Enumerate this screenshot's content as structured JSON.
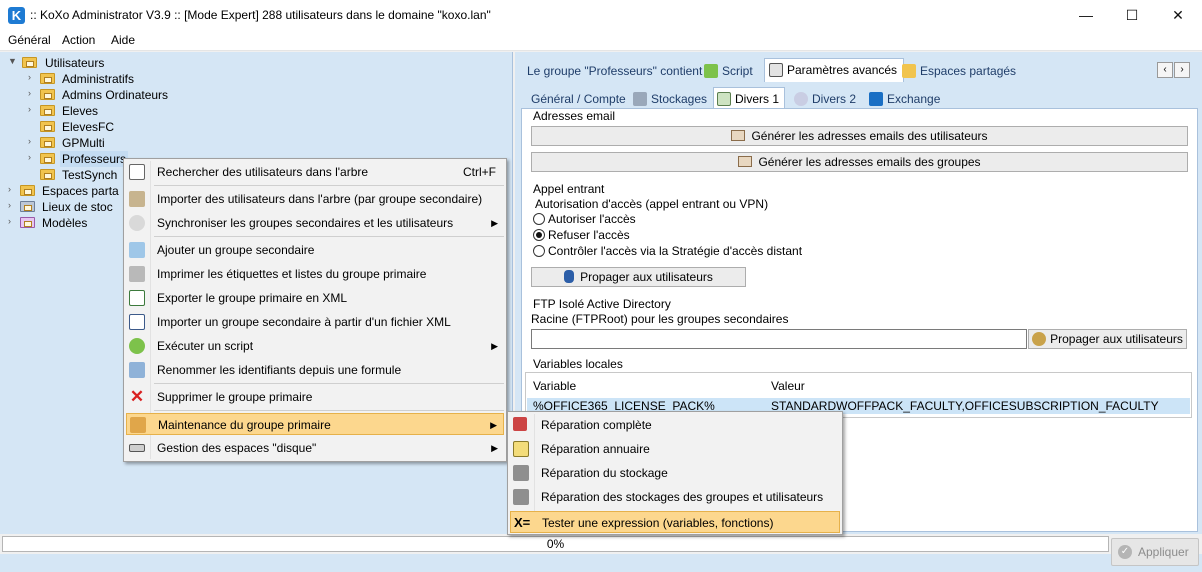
{
  "window": {
    "title": ":: KoXo Administrator V3.9 :: [Mode Expert] 288 utilisateurs dans le domaine \"koxo.lan\"",
    "logo_letter": "K",
    "minimize": "—",
    "maximize": "☐",
    "close": "✕"
  },
  "menubar": {
    "items": [
      "Général",
      "Action",
      "Aide"
    ]
  },
  "tree": {
    "root": "Utilisateurs",
    "children": [
      "Administratifs",
      "Admins Ordinateurs",
      "Eleves",
      "ElevesFC",
      "GPMulti",
      "Professeurs",
      "TestSynch"
    ],
    "others": [
      "Espaces partagés",
      "Lieux de stockage",
      "Modèles"
    ],
    "others_visible": [
      "Espaces parta",
      "Lieux de stoc",
      "Modèles"
    ]
  },
  "tabs_top": {
    "group_contains": "Le groupe \"Professeurs\" contient",
    "script": "Script",
    "advanced": "Paramètres avancés",
    "shared": "Espaces partagés"
  },
  "tabs_sub": [
    "Général / Compte",
    "Stockages",
    "Divers 1",
    "Divers 2",
    "Exchange"
  ],
  "content": {
    "email_section": "Adresses email",
    "gen_users_emails": "Générer les adresses emails des utilisateurs",
    "gen_groups_emails": "Générer les adresses emails des groupes",
    "incoming_section": "Appel entrant",
    "access_auth": "Autorisation d'accès (appel entrant ou VPN)",
    "radio_allow": "Autoriser l'accès",
    "radio_deny": "Refuser l'accès",
    "radio_policy": "Contrôler l'accès via la Stratégie d'accès distant",
    "propagate": "Propager aux utilisateurs",
    "ftp_section": "FTP Isolé Active Directory",
    "ftp_root": "Racine (FTPRoot) pour les groupes secondaires",
    "ftp_value": "",
    "propagate2": "Propager aux utilisateurs",
    "vars_section": "Variables locales",
    "col_variable": "Variable",
    "col_value": "Valeur",
    "var_name": "%OFFICE365_LICENSE_PACK%",
    "var_value": "STANDARDWOFFPACK_FACULTY,OFFICESUBSCRIPTION_FACULTY"
  },
  "context_menu": {
    "search": "Rechercher des utilisateurs dans l'arbre",
    "search_shortcut": "Ctrl+F",
    "import_users": "Importer des utilisateurs dans l'arbre (par groupe secondaire)",
    "sync": "Synchroniser les groupes secondaires et les utilisateurs",
    "add_group": "Ajouter un groupe secondaire",
    "print_labels": "Imprimer les étiquettes et listes du groupe primaire",
    "export_xml": "Exporter le groupe primaire en XML",
    "import_xml": "Importer un groupe secondaire à partir d'un fichier XML",
    "run_script": "Exécuter un script",
    "rename": "Renommer les identifiants depuis une formule",
    "delete": "Supprimer le groupe primaire",
    "maintenance": "Maintenance du groupe primaire",
    "disk_spaces": "Gestion des espaces \"disque\""
  },
  "sub_menu": {
    "full_repair": "Réparation complète",
    "directory_repair": "Réparation annuaire",
    "storage_repair": "Réparation du stockage",
    "groups_storage_repair": "Réparation des stockages des groupes et utilisateurs",
    "test_expression": "Tester une expression (variables, fonctions)"
  },
  "progress": {
    "value": 0,
    "label": "0%"
  },
  "apply_button": "Appliquer",
  "colors": {
    "panel": "#d5e6f5",
    "highlight": "#fcd78e",
    "selected_row": "#cce4f7"
  }
}
